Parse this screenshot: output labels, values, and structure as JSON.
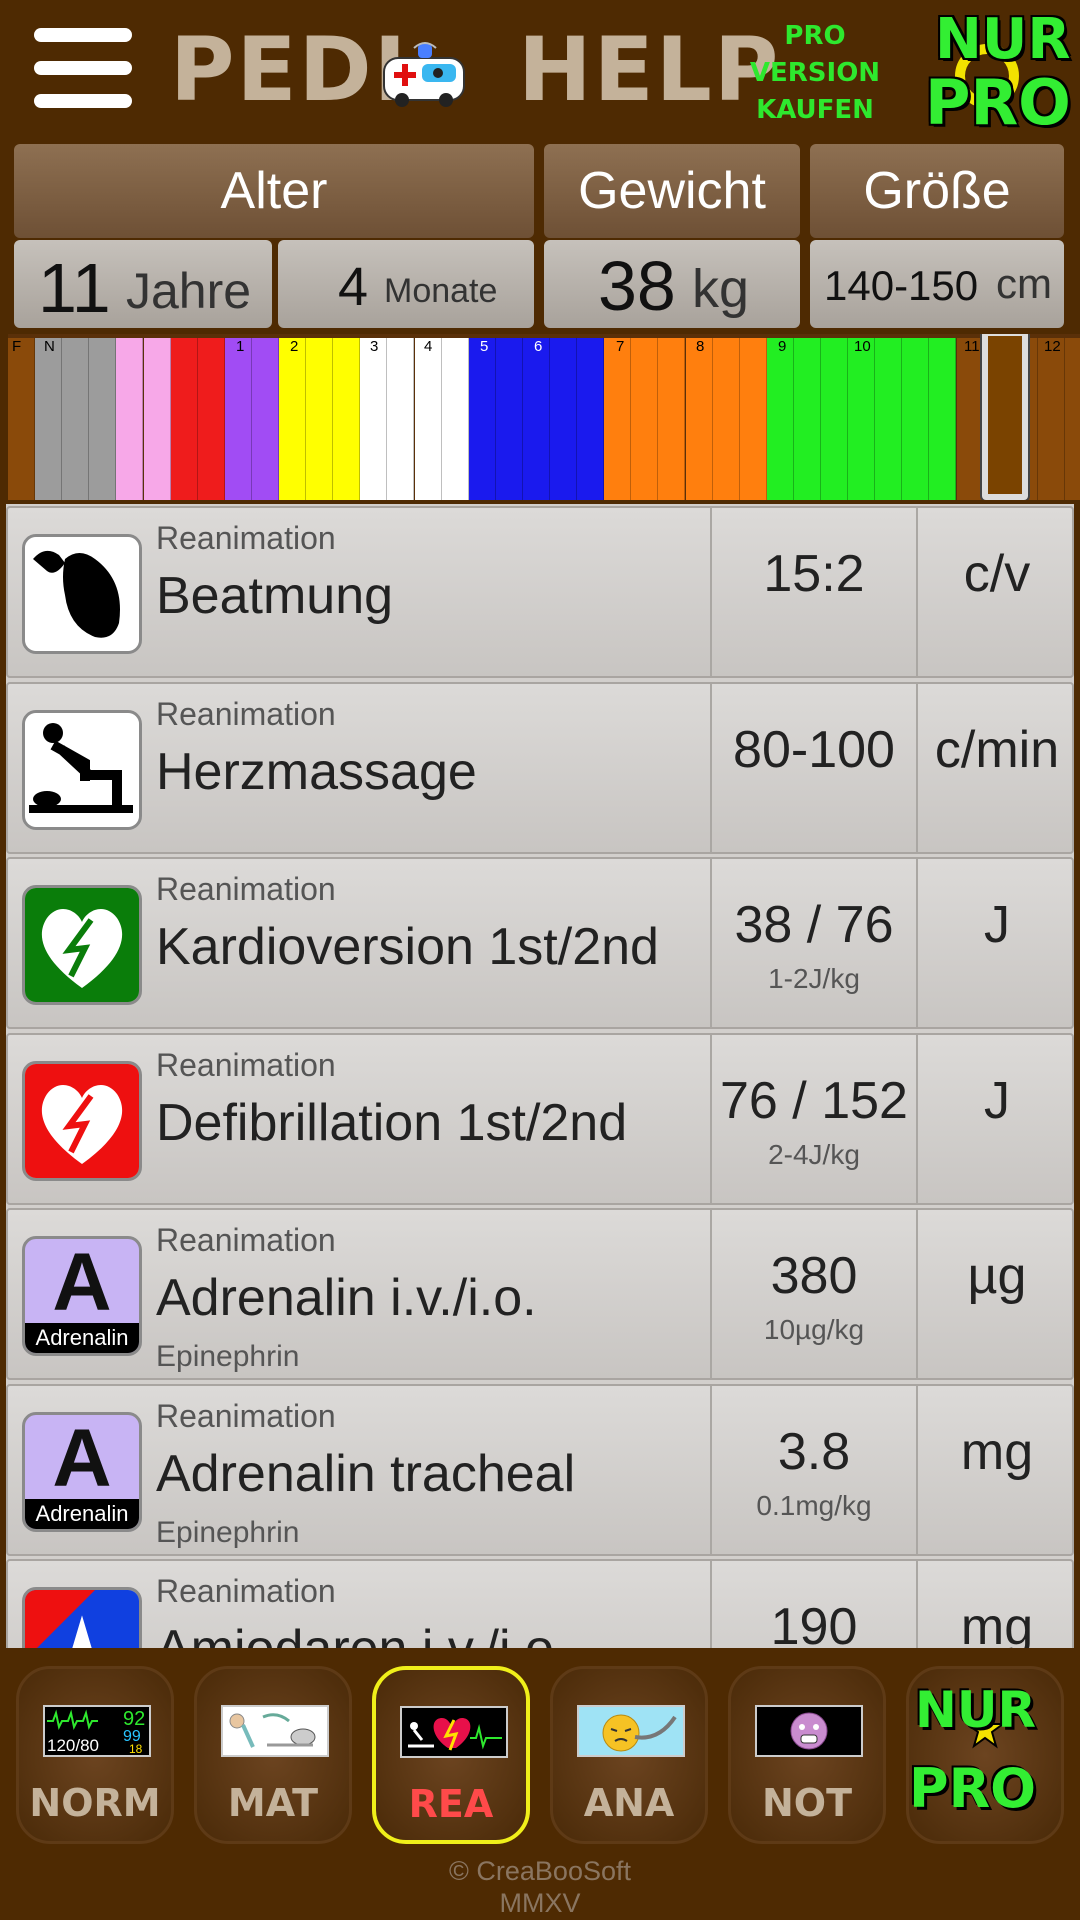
{
  "header": {
    "logo_left": "PEDI",
    "logo_right": "HELP",
    "buy_pro": [
      "PRO",
      "VERSION",
      "KAUFEN"
    ],
    "nur_pro": [
      "NUR",
      "PRO"
    ]
  },
  "selectors": {
    "age_label": "Alter",
    "weight_label": "Gewicht",
    "height_label": "Größe",
    "years_value": "11",
    "years_unit": "Jahre",
    "months_value": "4",
    "months_unit": "Monate",
    "weight_value": "38",
    "weight_unit": "kg",
    "height_value": "140-150",
    "height_unit": "cm"
  },
  "color_strip": {
    "labels": [
      "F",
      "N",
      "1",
      "2",
      "3",
      "4",
      "5",
      "6",
      "7",
      "8",
      "9",
      "10",
      "11",
      "12"
    ],
    "colors": {
      "brown": "#8a4a0a",
      "gray": "#9c9c9c",
      "pink": "#f7a8e8",
      "red": "#ef1c1c",
      "purple": "#a14cf4",
      "yellow": "#ffff00",
      "white": "#ffffff",
      "blue": "#1a1aee",
      "orange": "#ff7f0e",
      "green": "#22ee22"
    }
  },
  "rows": [
    {
      "category": "Reanimation",
      "name": "Beatmung",
      "subtitle": "",
      "value": "15:2",
      "dose": "",
      "unit": "c/v",
      "icon": "bag-valve-mask-icon"
    },
    {
      "category": "Reanimation",
      "name": "Herzmassage",
      "subtitle": "",
      "value": "80-100",
      "dose": "",
      "unit": "c/min",
      "icon": "cpr-icon"
    },
    {
      "category": "Reanimation",
      "name": "Kardioversion 1st/2nd",
      "subtitle": "",
      "value": "38 / 76",
      "dose": "1-2J/kg",
      "unit": "J",
      "icon": "green-heart-bolt-icon"
    },
    {
      "category": "Reanimation",
      "name": "Defibrillation 1st/2nd",
      "subtitle": "",
      "value": "76 / 152",
      "dose": "2-4J/kg",
      "unit": "J",
      "icon": "red-heart-bolt-icon"
    },
    {
      "category": "Reanimation",
      "name": "Adrenalin i.v./i.o.",
      "subtitle": "Epinephrin",
      "value": "380",
      "dose": "10µg/kg",
      "unit": "µg",
      "icon": "adrenalin-icon",
      "icon_text": "A",
      "icon_caption": "Adrenalin"
    },
    {
      "category": "Reanimation",
      "name": "Adrenalin tracheal",
      "subtitle": "Epinephrin",
      "value": "3.8",
      "dose": "0.1mg/kg",
      "unit": "mg",
      "icon": "adrenalin-icon",
      "icon_text": "A",
      "icon_caption": "Adrenalin"
    },
    {
      "category": "Reanimation",
      "name": "Amiodaren i.v./i.o.",
      "subtitle": "",
      "value": "190",
      "dose": "",
      "unit": "mg",
      "icon": "amiodarone-icon",
      "icon_text": "A"
    }
  ],
  "nav": {
    "items": [
      "NORM",
      "MAT",
      "REA",
      "ANA",
      "NOT"
    ],
    "nur_pro": [
      "NUR",
      "PRO"
    ],
    "monitor": {
      "bp": "120/80",
      "hr": "92",
      "spo2": "99",
      "rr": "18"
    },
    "active": "REA"
  },
  "footer": {
    "copyright": "© CreaBooSoft",
    "year": "MMXV"
  }
}
